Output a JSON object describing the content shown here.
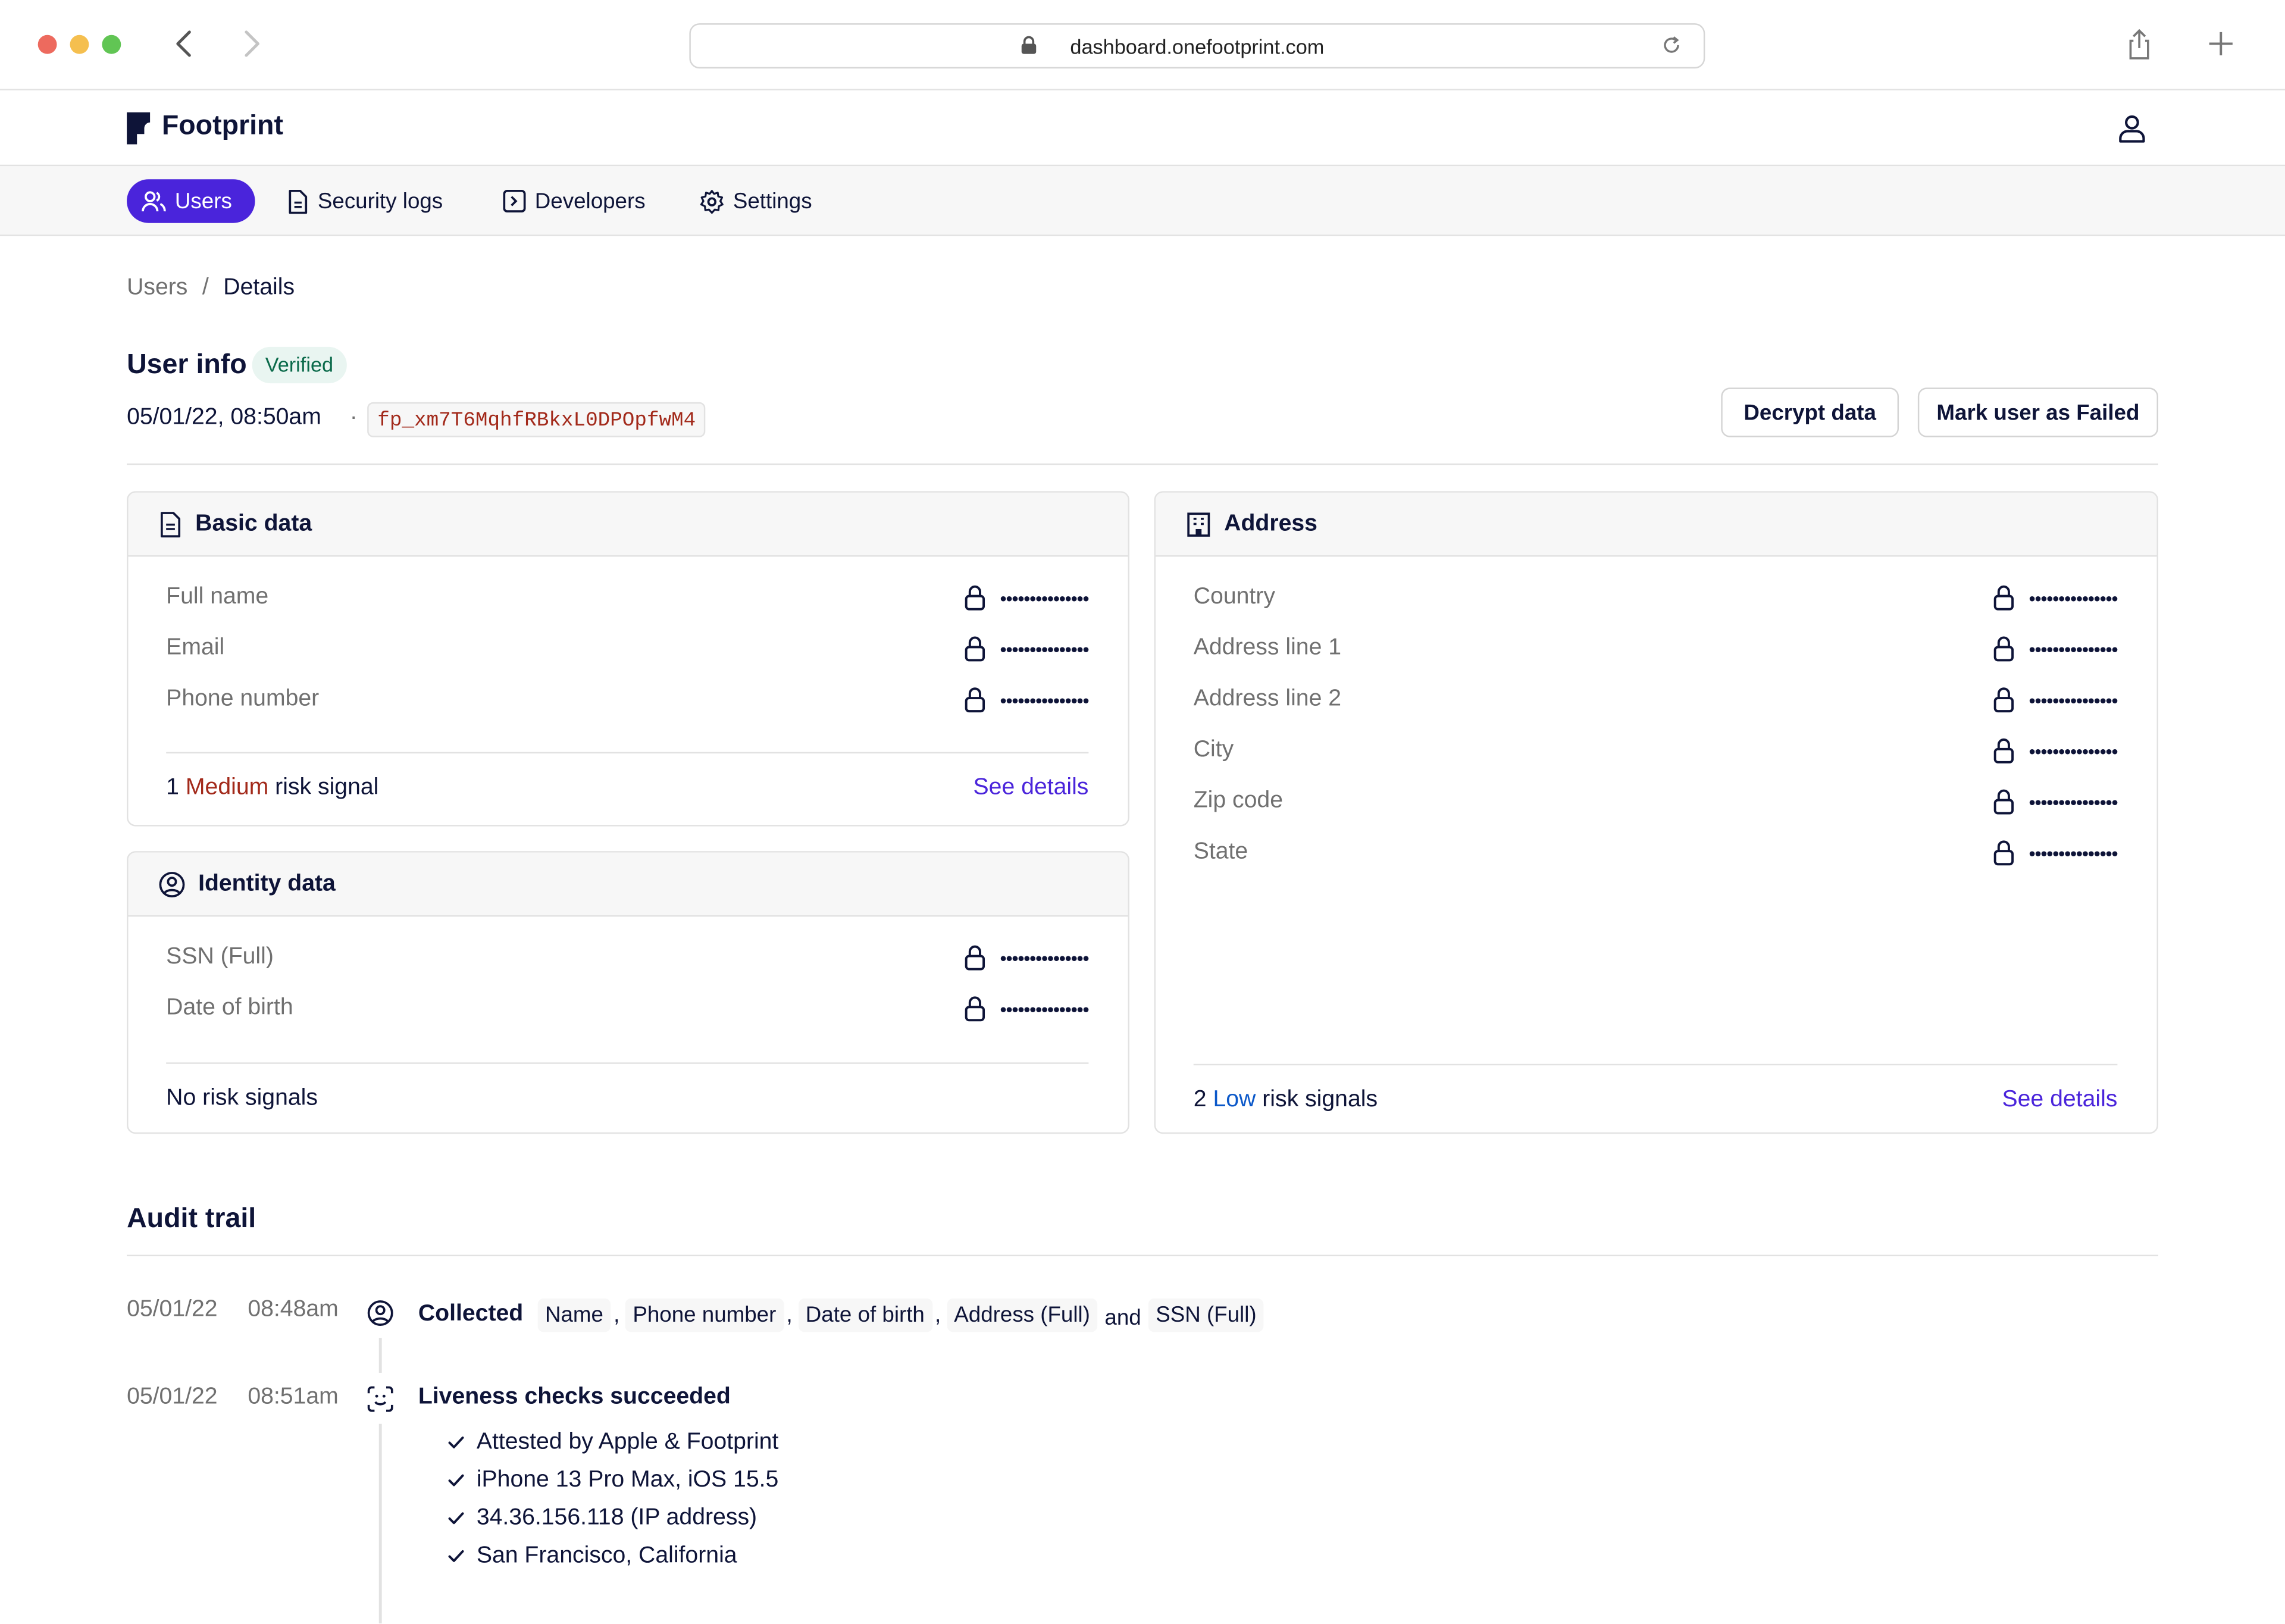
{
  "browser": {
    "url": "dashboard.onefootprint.com",
    "traffic_lights": {
      "close": "#ed6a5e",
      "minimize": "#f5bf4f",
      "maximize": "#61c554"
    }
  },
  "app": {
    "logo_text": "Footprint",
    "accent_color": "#4a24db"
  },
  "nav": {
    "items": [
      {
        "label": "Users",
        "icon": "users-icon",
        "active": true
      },
      {
        "label": "Security logs",
        "icon": "document-icon",
        "active": false
      },
      {
        "label": "Developers",
        "icon": "terminal-icon",
        "active": false
      },
      {
        "label": "Settings",
        "icon": "gear-icon",
        "active": false
      }
    ]
  },
  "breadcrumb": {
    "parent": "Users",
    "separator": "/",
    "current": "Details"
  },
  "user_info": {
    "title": "User info",
    "status_badge": "Verified",
    "timestamp": "05/01/22, 08:50am",
    "meta_separator": "·",
    "footprint_id": "fp_xm7T6MqhfRBkxL0DPOpfwM4",
    "actions": {
      "decrypt": "Decrypt data",
      "mark_failed": "Mark user as Failed"
    }
  },
  "cards": {
    "basic": {
      "title": "Basic data",
      "fields": [
        {
          "label": "Full name",
          "value": "•••••••••••••••"
        },
        {
          "label": "Email",
          "value": "•••••••••••••••"
        },
        {
          "label": "Phone number",
          "value": "•••••••••••••••"
        }
      ],
      "risk": {
        "count": "1",
        "level": "Medium",
        "suffix": "risk signal",
        "link": "See details"
      }
    },
    "identity": {
      "title": "Identity data",
      "fields": [
        {
          "label": "SSN (Full)",
          "value": "•••••••••••••••"
        },
        {
          "label": "Date of birth",
          "value": "•••••••••••••••"
        }
      ],
      "risk": {
        "text": "No risk signals"
      }
    },
    "address": {
      "title": "Address",
      "fields": [
        {
          "label": "Country",
          "value": "•••••••••••••••"
        },
        {
          "label": "Address line 1",
          "value": "•••••••••••••••"
        },
        {
          "label": "Address line 2",
          "value": "•••••••••••••••"
        },
        {
          "label": "City",
          "value": "•••••••••••••••"
        },
        {
          "label": "Zip code",
          "value": "•••••••••••••••"
        },
        {
          "label": "State",
          "value": "•••••••••••••••"
        }
      ],
      "risk": {
        "count": "2",
        "level": "Low",
        "suffix": "risk signals",
        "link": "See details"
      }
    }
  },
  "audit": {
    "title": "Audit trail",
    "events": [
      {
        "date": "05/01/22",
        "time": "08:48am",
        "icon": "user-circle-icon",
        "title": "Collected",
        "chips": [
          "Name",
          "Phone number",
          "Date of birth",
          "Address (Full)",
          "SSN (Full)"
        ],
        "comma": ",",
        "conjunction": "and"
      },
      {
        "date": "05/01/22",
        "time": "08:51am",
        "icon": "face-scan-icon",
        "title": "Liveness checks succeeded",
        "checks": [
          "Attested by Apple & Footprint",
          "iPhone 13 Pro Max, iOS 15.5",
          "34.36.156.118 (IP address)",
          "San Francisco, California"
        ]
      }
    ]
  }
}
